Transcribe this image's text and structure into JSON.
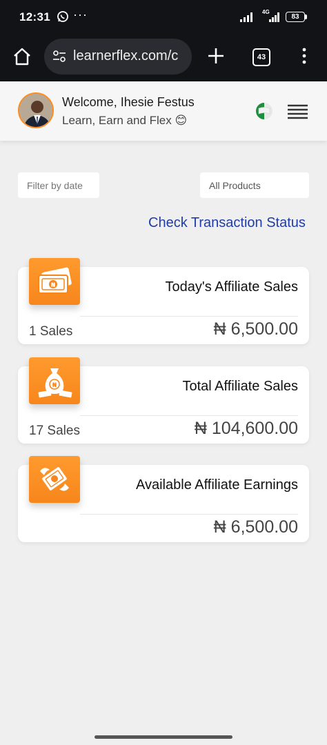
{
  "status_bar": {
    "time": "12:31",
    "dots": "···",
    "network": "4G",
    "battery": "83"
  },
  "browser": {
    "url": "learnerflex.com/c",
    "tab_count": "43"
  },
  "header": {
    "welcome": "Welcome, Ihesie Festus",
    "tagline": "Learn, Earn and Flex 😊"
  },
  "filters": {
    "date_placeholder": "Filter by date",
    "products_selected": "All Products"
  },
  "links": {
    "check_status": "Check Transaction Status"
  },
  "cards": [
    {
      "icon": "naira-banknote-icon",
      "title": "Today's Affiliate Sales",
      "count": "1 Sales",
      "amount": "₦ 6,500.00"
    },
    {
      "icon": "naira-money-bag-icon",
      "title": "Total Affiliate Sales",
      "count": "17 Sales",
      "amount": "₦ 104,600.00"
    },
    {
      "icon": "flying-money-icon",
      "title": "Available Affiliate Earnings",
      "count": "",
      "amount": "₦ 6,500.00"
    }
  ],
  "colors": {
    "accent_orange": "#f7861b",
    "link_blue": "#1f3ca8",
    "dark_bar": "#121316"
  }
}
